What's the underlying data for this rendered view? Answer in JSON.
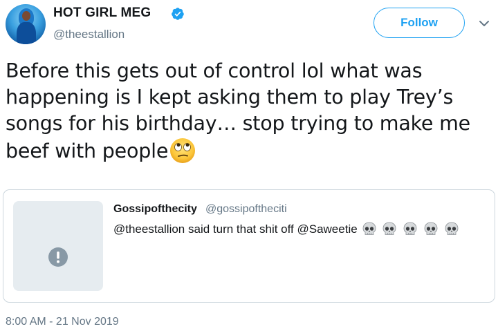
{
  "author": {
    "display_name": "HOT GIRL MEG",
    "handle": "@theestallion",
    "verified": true
  },
  "follow_label": "Follow",
  "tweet": {
    "text": "Before this gets out of control lol what was happening is I kept asking them to play Trey’s songs for his birthday… stop trying to make me beef with people",
    "emoji": "face-with-rolling-eyes"
  },
  "quoted_tweet": {
    "name": "Gossipofthecity",
    "handle": "@gossipoftheciti",
    "text": "@theestallion said turn that shit off @Saweetie",
    "emoji": [
      "skull",
      "skull",
      "skull",
      "skull",
      "skull"
    ]
  },
  "timestamp": "8:00 AM - 21 Nov 2019",
  "colors": {
    "accent": "#1da1f2",
    "text_primary": "#14171a",
    "text_secondary": "#657786",
    "border": "#ccd6dd",
    "media_placeholder": "#e6ecf0"
  }
}
